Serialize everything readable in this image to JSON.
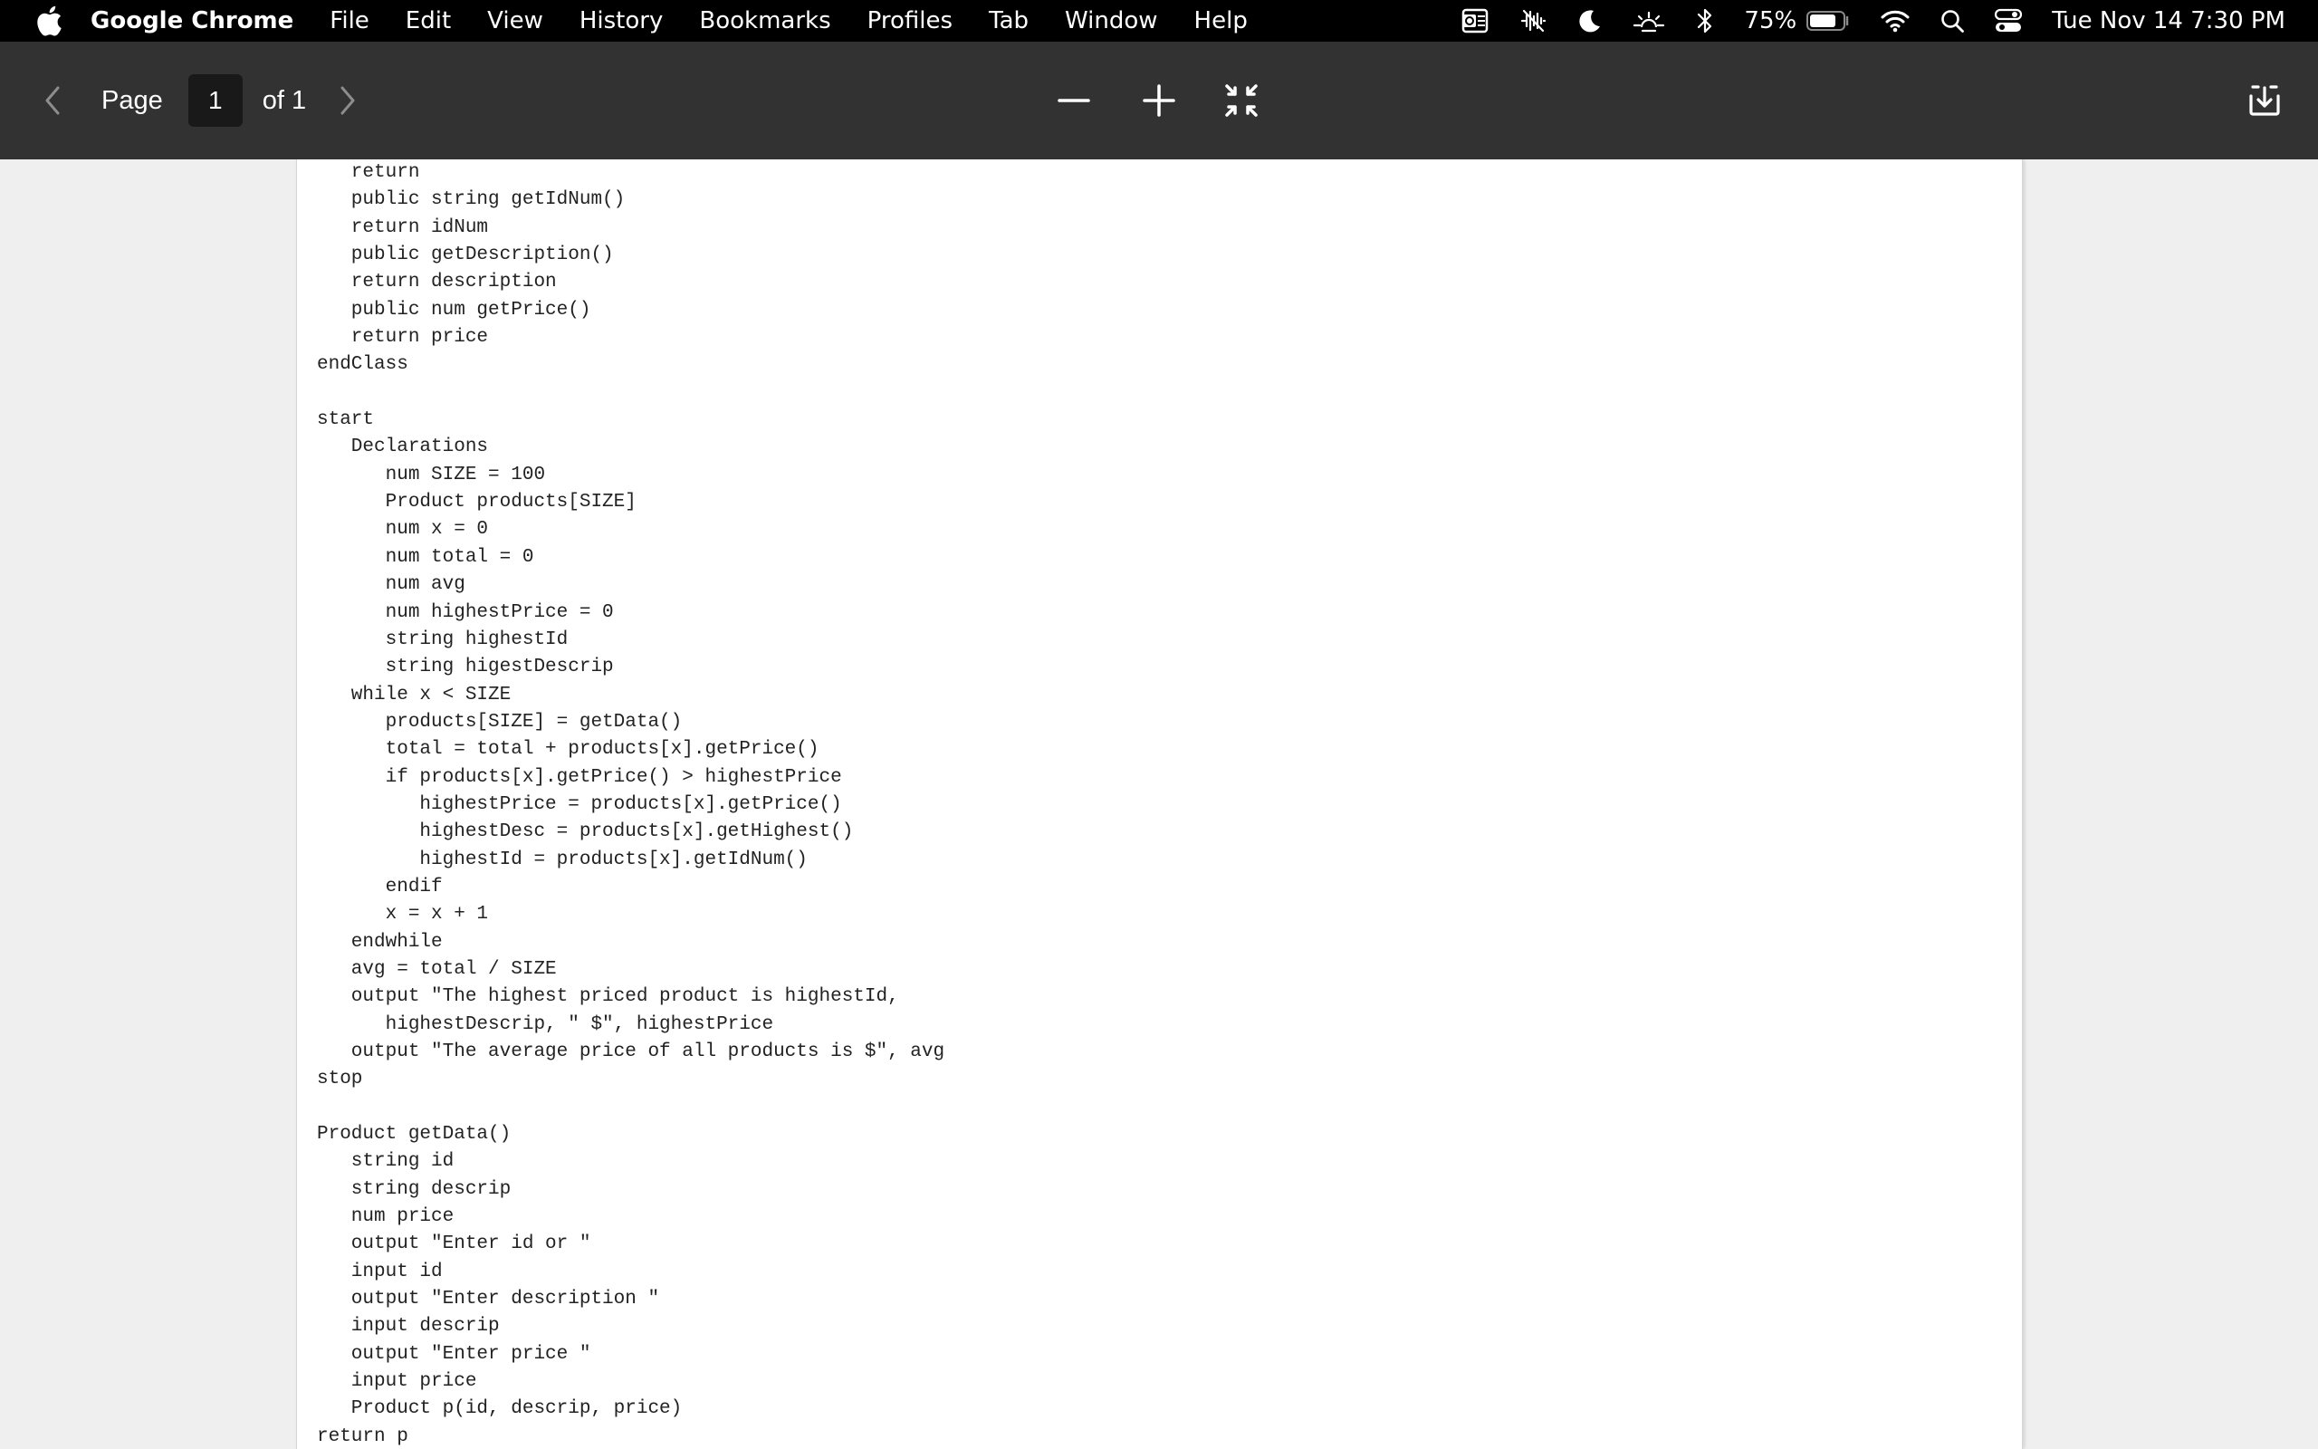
{
  "menubar": {
    "app_name": "Google Chrome",
    "menus": [
      "File",
      "Edit",
      "View",
      "History",
      "Bookmarks",
      "Profiles",
      "Tab",
      "Window",
      "Help"
    ],
    "battery_percent": "75%",
    "datetime": "Tue Nov 14  7:30 PM"
  },
  "toolbar": {
    "page_label": "Page",
    "current_page": "1",
    "page_total": "of 1"
  },
  "document": {
    "lines": [
      "   return",
      "   public string getIdNum()",
      "   return idNum",
      "   public getDescription()",
      "   return description",
      "   public num getPrice()",
      "   return price",
      "endClass",
      "",
      "start",
      "   Declarations",
      "      num SIZE = 100",
      "      Product products[SIZE]",
      "      num x = 0",
      "      num total = 0",
      "      num avg",
      "      num highestPrice = 0",
      "      string highestId",
      "      string higestDescrip",
      "   while x < SIZE",
      "      products[SIZE] = getData()",
      "      total = total + products[x].getPrice()",
      "      if products[x].getPrice() > highestPrice",
      "         highestPrice = products[x].getPrice()",
      "         highestDesc = products[x].getHighest()",
      "         highestId = products[x].getIdNum()",
      "      endif",
      "      x = x + 1",
      "   endwhile",
      "   avg = total / SIZE",
      "   output \"The highest priced product is highestId,",
      "      highestDescrip, \" $\", highestPrice",
      "   output \"The average price of all products is $\", avg",
      "stop",
      "",
      "Product getData()",
      "   string id",
      "   string descrip",
      "   num price",
      "   output \"Enter id or \"",
      "   input id",
      "   output \"Enter description \"",
      "   input descrip",
      "   output \"Enter price \"",
      "   input price",
      "   Product p(id, descrip, price)",
      "return p"
    ]
  }
}
